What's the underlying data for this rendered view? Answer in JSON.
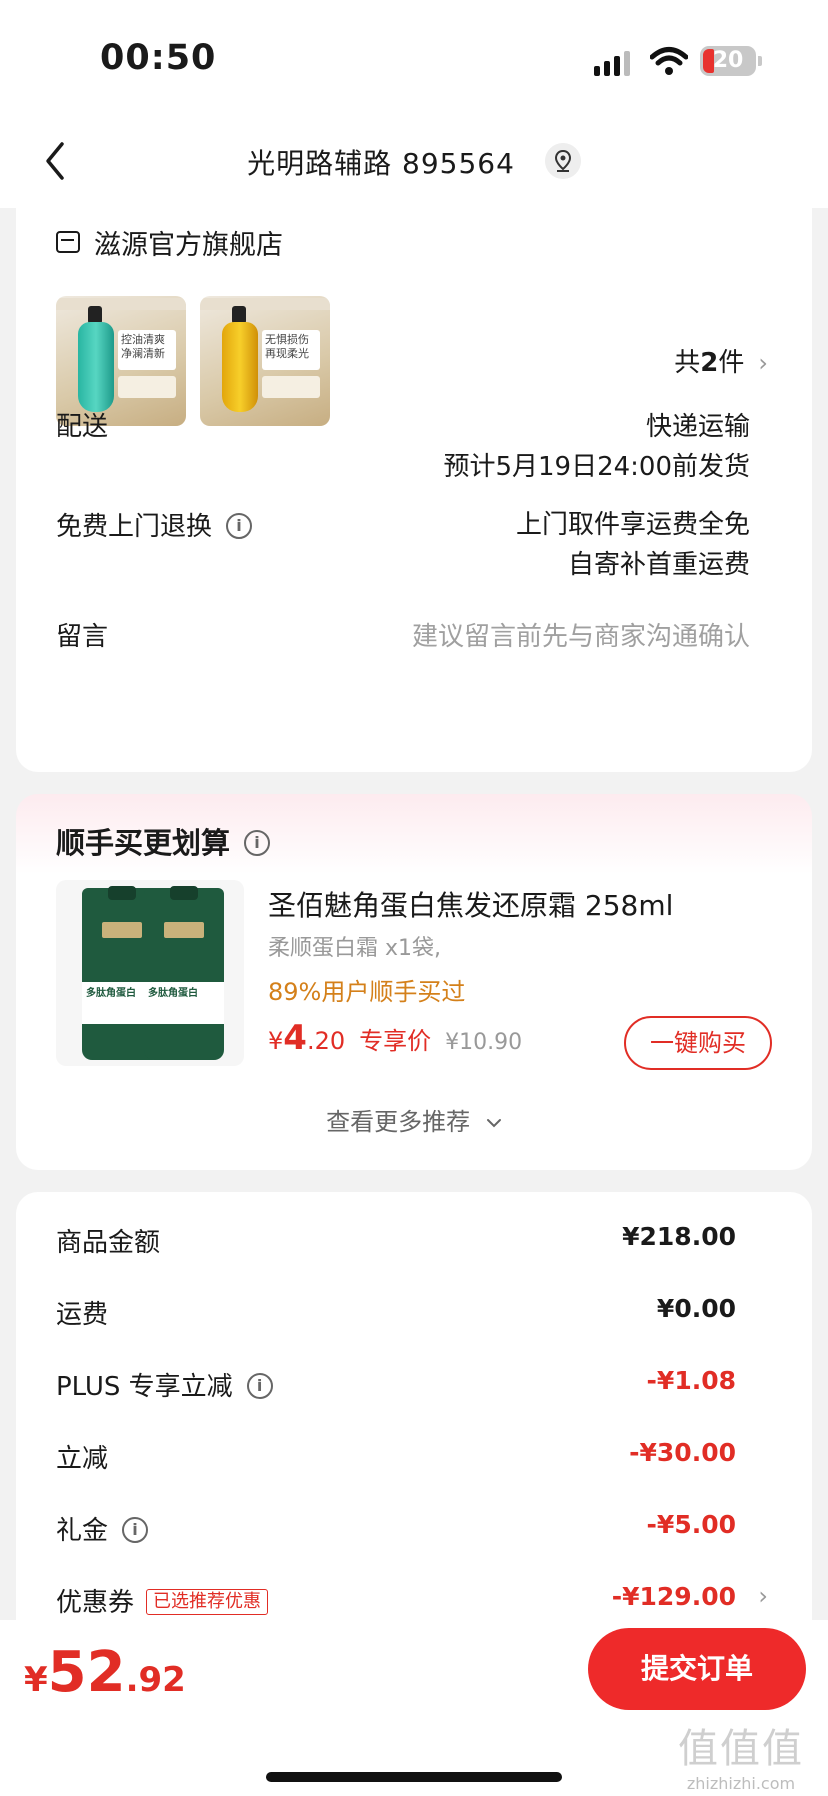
{
  "status_bar": {
    "time": "00:50",
    "battery": "20"
  },
  "nav": {
    "title": "光明路辅路 895564"
  },
  "store": {
    "name": "滋源官方旗舰店",
    "products": [
      {
        "label": "控油清爽\n净澜清新"
      },
      {
        "label": "无惧损伤\n再现柔光"
      }
    ],
    "count_prefix": "共",
    "count_num": "2",
    "count_suffix": "件"
  },
  "delivery": {
    "label": "配送",
    "method": "快递运输",
    "estimate": "预计5月19日24:00前发货"
  },
  "returns": {
    "label": "免费上门退换",
    "line1": "上门取件享运费全免",
    "line2": "自寄补首重运费"
  },
  "message": {
    "label": "留言",
    "placeholder": "建议留言前先与商家沟通确认"
  },
  "recommend": {
    "title": "顺手买更划算",
    "product_name": "圣佰魅角蛋白焦发还原霜 258ml",
    "spec": "柔顺蛋白霜 x1袋,",
    "rate": "89%用户顺手买过",
    "price_symbol": "¥",
    "price_int": "4",
    "price_dec": ".20",
    "price_tag": "专享价",
    "orig_price": "¥10.90",
    "buy_label": "一键购买",
    "more_label": "查看更多推荐",
    "pouch_text": "多肽角蛋白"
  },
  "amounts": [
    {
      "label": "商品金额",
      "value": "¥218.00",
      "red": false
    },
    {
      "label": "运费",
      "value": "¥0.00",
      "red": false
    },
    {
      "label": "PLUS 专享立减",
      "value": "-¥1.08",
      "red": true
    },
    {
      "label": "立减",
      "value": "-¥30.00",
      "red": true
    },
    {
      "label": "礼金",
      "value": "-¥5.00",
      "red": true
    },
    {
      "label": "优惠券",
      "value": "-¥129.00",
      "red": true,
      "tag": "已选推荐优惠"
    }
  ],
  "bottom": {
    "symbol": "¥",
    "total_int": "52",
    "total_dec": ".92",
    "submit_label": "提交订单",
    "watermark": "值值值",
    "watermark_url": "zhizhizhi.com"
  },
  "colors": {
    "accent_red": "#e12d25",
    "rate_orange": "#d4801a"
  }
}
